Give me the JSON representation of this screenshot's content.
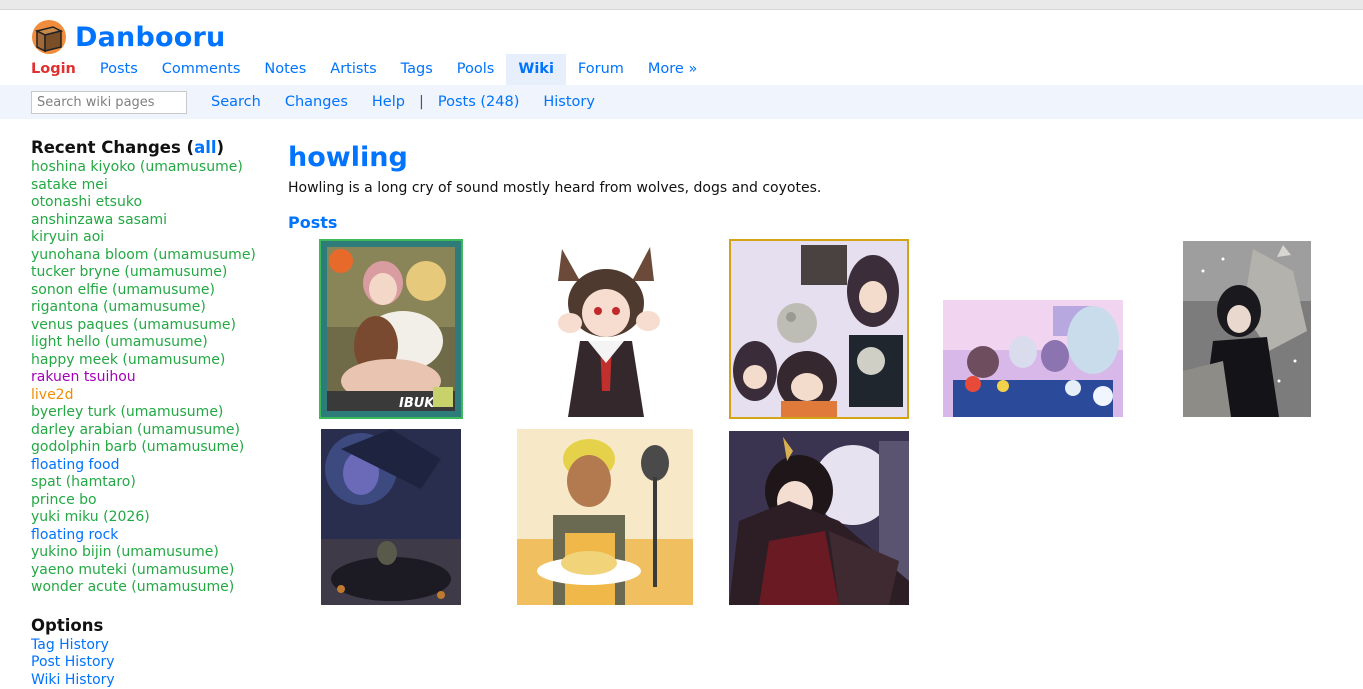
{
  "site": {
    "title": "Danbooru",
    "logo_icon": "box-icon"
  },
  "top_nav": [
    {
      "label": "Login",
      "kind": "login"
    },
    {
      "label": "Posts"
    },
    {
      "label": "Comments"
    },
    {
      "label": "Notes"
    },
    {
      "label": "Artists"
    },
    {
      "label": "Tags"
    },
    {
      "label": "Pools"
    },
    {
      "label": "Wiki",
      "active": true
    },
    {
      "label": "Forum"
    },
    {
      "label": "More »"
    }
  ],
  "subnav": {
    "search_placeholder": "Search wiki pages",
    "items": [
      "Search",
      "Changes",
      "Help",
      "|",
      "Posts (248)",
      "History"
    ]
  },
  "sidebar": {
    "recent_heading_prefix": "Recent Changes (",
    "recent_heading_link": "all",
    "recent_heading_suffix": ")",
    "recent_changes": [
      {
        "label": "hoshina kiyoko (umamusume)",
        "color": "#24a844"
      },
      {
        "label": "satake mei",
        "color": "#24a844"
      },
      {
        "label": "otonashi etsuko",
        "color": "#24a844"
      },
      {
        "label": "anshinzawa sasami",
        "color": "#24a844"
      },
      {
        "label": "kiryuin aoi",
        "color": "#24a844"
      },
      {
        "label": "yunohana bloom (umamusume)",
        "color": "#24a844"
      },
      {
        "label": "tucker bryne (umamusume)",
        "color": "#24a844"
      },
      {
        "label": "sonon elfie (umamusume)",
        "color": "#24a844"
      },
      {
        "label": "rigantona (umamusume)",
        "color": "#24a844"
      },
      {
        "label": "venus paques (umamusume)",
        "color": "#24a844"
      },
      {
        "label": "light hello (umamusume)",
        "color": "#24a844"
      },
      {
        "label": "happy meek (umamusume)",
        "color": "#24a844"
      },
      {
        "label": "rakuen tsuihou",
        "color": "#a300b8"
      },
      {
        "label": "live2d",
        "color": "#f08c00"
      },
      {
        "label": "byerley turk (umamusume)",
        "color": "#24a844"
      },
      {
        "label": "darley arabian (umamusume)",
        "color": "#24a844"
      },
      {
        "label": "godolphin barb (umamusume)",
        "color": "#24a844"
      },
      {
        "label": "floating food",
        "color": "#0073ff"
      },
      {
        "label": "spat (hamtaro)",
        "color": "#24a844"
      },
      {
        "label": "prince bo",
        "color": "#24a844"
      },
      {
        "label": "yuki miku (2026)",
        "color": "#24a844"
      },
      {
        "label": "floating rock",
        "color": "#0073ff"
      },
      {
        "label": "yukino bijin (umamusume)",
        "color": "#24a844"
      },
      {
        "label": "yaeno muteki (umamusume)",
        "color": "#24a844"
      },
      {
        "label": "wonder acute (umamusume)",
        "color": "#24a844"
      }
    ],
    "options_heading": "Options",
    "options": [
      "Tag History",
      "Post History",
      "Wiki History"
    ]
  },
  "wiki": {
    "title": "howling",
    "body": "Howling is a long cry of sound mostly heard from wolves, dogs and coyotes.",
    "posts_heading": "Posts"
  },
  "colors": {
    "link_blue": "#0073ff",
    "login_red": "#e03030",
    "general_tag_green": "#24a844",
    "copyright_purple": "#a300b8",
    "meta_orange": "#f08c00",
    "thumb_border_green": "#3cb95a",
    "thumb_border_gold": "#d4a316",
    "subnav_bg": "#f0f4fc"
  },
  "posts": [
    {
      "name": "post-thumb-wolf-girl-card",
      "border": "green",
      "text": "IBUKI"
    },
    {
      "name": "post-thumb-wolf-ears-girl"
    },
    {
      "name": "post-thumb-wolf-girls-collage",
      "border": "gold"
    },
    {
      "name": "post-thumb-party-table"
    },
    {
      "name": "post-thumb-wolves-snow"
    },
    {
      "name": "post-thumb-night-moon-figure"
    },
    {
      "name": "post-thumb-chef-fried-rice"
    },
    {
      "name": "post-thumb-winged-girl-moon"
    }
  ]
}
